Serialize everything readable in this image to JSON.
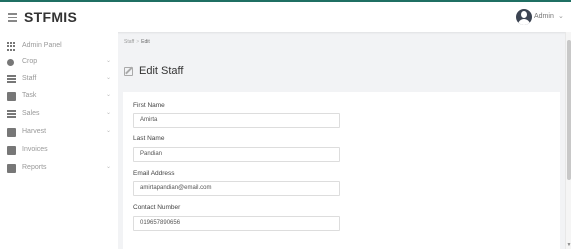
{
  "app": {
    "brand": "STFMIS"
  },
  "user": {
    "name": "Admin",
    "caret": "⌄"
  },
  "sidebar": {
    "items": [
      {
        "label": "Admin Panel",
        "icon": "grid-icon"
      },
      {
        "label": "Crop",
        "icon": "leaf-icon",
        "chevron": "⌄"
      },
      {
        "label": "Staff",
        "icon": "users-icon",
        "chevron": "⌄"
      },
      {
        "label": "Task",
        "icon": "checkbox-icon",
        "chevron": "⌄"
      },
      {
        "label": "Sales",
        "icon": "chart-icon",
        "chevron": "⌄"
      },
      {
        "label": "Harvest",
        "icon": "basket-icon",
        "chevron": "⌄"
      },
      {
        "label": "Invoices",
        "icon": "invoice-icon"
      },
      {
        "label": "Reports",
        "icon": "report-icon",
        "chevron": "⌄"
      }
    ]
  },
  "breadcrumb": {
    "parent": "Staff",
    "separator": ">",
    "current": "Edit"
  },
  "page": {
    "title": "Edit Staff"
  },
  "form": {
    "first_name": {
      "label": "First Name",
      "value": "Amirta"
    },
    "last_name": {
      "label": "Last Name",
      "value": "Pandian"
    },
    "email": {
      "label": "Email Address",
      "value": "amirtapandian@email.com"
    },
    "contact": {
      "label": "Contact Number",
      "value": "019657890656"
    }
  }
}
